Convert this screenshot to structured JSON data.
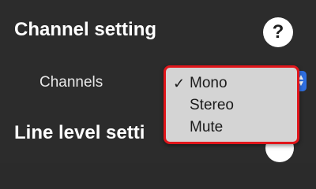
{
  "channel_section": {
    "title": "Channel setting",
    "help_symbol": "?",
    "channels_label": "Channels"
  },
  "dropdown": {
    "check_symbol": "✓",
    "options": [
      {
        "label": "Mono",
        "selected": true
      },
      {
        "label": "Stereo",
        "selected": false
      },
      {
        "label": "Mute",
        "selected": false
      }
    ]
  },
  "line_level_section": {
    "title": "Line level setti"
  },
  "colors": {
    "background": "#2c2c2c",
    "dropdown_bg": "#d4d4d4",
    "highlight_border": "#e0161b",
    "select_accent": "#2f6fe0"
  },
  "icons": {
    "help": "question-circle-icon",
    "check": "checkmark-icon",
    "select_arrows": "chevron-updown-icon"
  }
}
